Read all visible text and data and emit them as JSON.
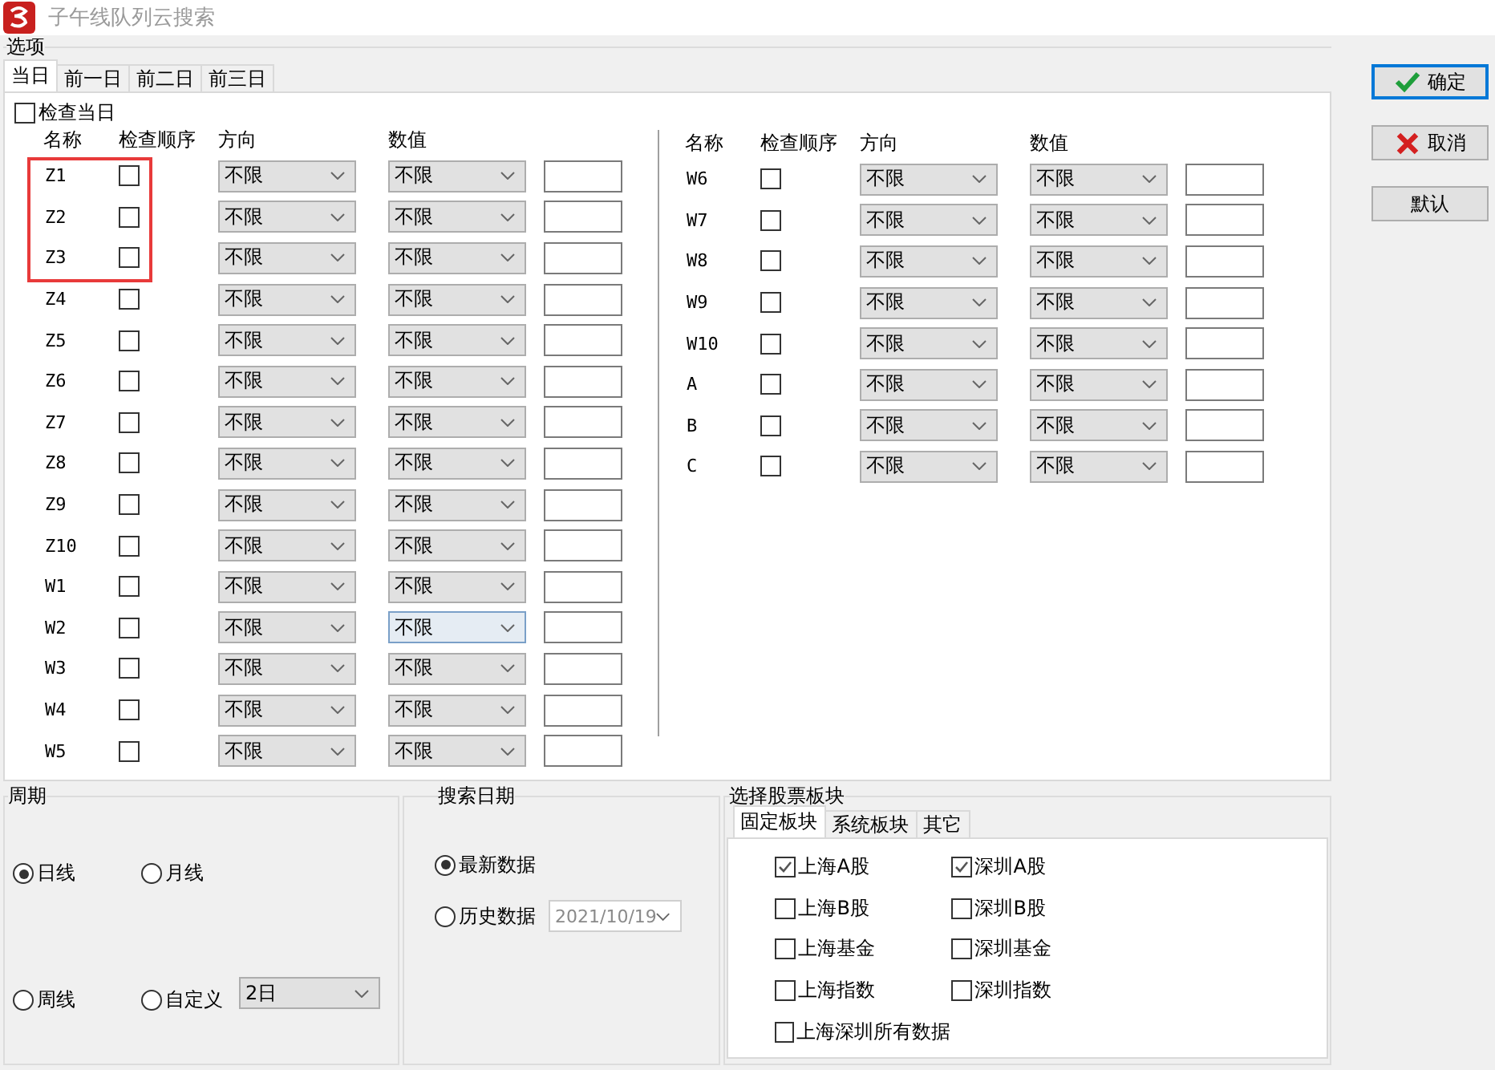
{
  "window": {
    "title": "子午线队列云搜索"
  },
  "options": {
    "label": "选项",
    "tabs": [
      {
        "label": "当日",
        "selected": true
      },
      {
        "label": "前一日",
        "selected": false
      },
      {
        "label": "前二日",
        "selected": false
      },
      {
        "label": "前三日",
        "selected": false
      }
    ],
    "check_today": {
      "label": "检查当日",
      "checked": false
    },
    "panels": [
      {
        "headers": [
          "名称",
          "检查顺序",
          "方向",
          "数值"
        ],
        "rows": [
          {
            "name": "Z1",
            "order_checked": false,
            "direction": "不限",
            "value": "不限",
            "value_focused": false,
            "highlighted": true
          },
          {
            "name": "Z2",
            "order_checked": false,
            "direction": "不限",
            "value": "不限",
            "value_focused": false,
            "highlighted": true
          },
          {
            "name": "Z3",
            "order_checked": false,
            "direction": "不限",
            "value": "不限",
            "value_focused": false,
            "highlighted": true
          },
          {
            "name": "Z4",
            "order_checked": false,
            "direction": "不限",
            "value": "不限",
            "value_focused": false,
            "highlighted": false
          },
          {
            "name": "Z5",
            "order_checked": false,
            "direction": "不限",
            "value": "不限",
            "value_focused": false,
            "highlighted": false
          },
          {
            "name": "Z6",
            "order_checked": false,
            "direction": "不限",
            "value": "不限",
            "value_focused": false,
            "highlighted": false
          },
          {
            "name": "Z7",
            "order_checked": false,
            "direction": "不限",
            "value": "不限",
            "value_focused": false,
            "highlighted": false
          },
          {
            "name": "Z8",
            "order_checked": false,
            "direction": "不限",
            "value": "不限",
            "value_focused": false,
            "highlighted": false
          },
          {
            "name": "Z9",
            "order_checked": false,
            "direction": "不限",
            "value": "不限",
            "value_focused": false,
            "highlighted": false
          },
          {
            "name": "Z10",
            "order_checked": false,
            "direction": "不限",
            "value": "不限",
            "value_focused": false,
            "highlighted": false
          },
          {
            "name": "W1",
            "order_checked": false,
            "direction": "不限",
            "value": "不限",
            "value_focused": false,
            "highlighted": false
          },
          {
            "name": "W2",
            "order_checked": false,
            "direction": "不限",
            "value": "不限",
            "value_focused": true,
            "highlighted": false
          },
          {
            "name": "W3",
            "order_checked": false,
            "direction": "不限",
            "value": "不限",
            "value_focused": false,
            "highlighted": false
          },
          {
            "name": "W4",
            "order_checked": false,
            "direction": "不限",
            "value": "不限",
            "value_focused": false,
            "highlighted": false
          },
          {
            "name": "W5",
            "order_checked": false,
            "direction": "不限",
            "value": "不限",
            "value_focused": false,
            "highlighted": false
          }
        ]
      },
      {
        "headers": [
          "名称",
          "检查顺序",
          "方向",
          "数值"
        ],
        "rows": [
          {
            "name": "W6",
            "order_checked": false,
            "direction": "不限",
            "value": "不限",
            "value_focused": false,
            "highlighted": false
          },
          {
            "name": "W7",
            "order_checked": false,
            "direction": "不限",
            "value": "不限",
            "value_focused": false,
            "highlighted": false
          },
          {
            "name": "W8",
            "order_checked": false,
            "direction": "不限",
            "value": "不限",
            "value_focused": false,
            "highlighted": false
          },
          {
            "name": "W9",
            "order_checked": false,
            "direction": "不限",
            "value": "不限",
            "value_focused": false,
            "highlighted": false
          },
          {
            "name": "W10",
            "order_checked": false,
            "direction": "不限",
            "value": "不限",
            "value_focused": false,
            "highlighted": false
          },
          {
            "name": "A",
            "order_checked": false,
            "direction": "不限",
            "value": "不限",
            "value_focused": false,
            "highlighted": false
          },
          {
            "name": "B",
            "order_checked": false,
            "direction": "不限",
            "value": "不限",
            "value_focused": false,
            "highlighted": false
          },
          {
            "name": "C",
            "order_checked": false,
            "direction": "不限",
            "value": "不限",
            "value_focused": false,
            "highlighted": false
          }
        ]
      }
    ]
  },
  "period": {
    "label": "周期",
    "options": [
      {
        "label": "日线",
        "selected": true
      },
      {
        "label": "月线",
        "selected": false
      },
      {
        "label": "周线",
        "selected": false
      },
      {
        "label": "自定义",
        "selected": false
      }
    ],
    "custom": "2日"
  },
  "search_date": {
    "label": "搜索日期",
    "options": [
      {
        "label": "最新数据",
        "selected": true
      },
      {
        "label": "历史数据",
        "selected": false
      }
    ],
    "date": {
      "value": "2021/10/19",
      "disabled": true
    }
  },
  "board": {
    "label": "选择股票板块",
    "tabs": [
      {
        "label": "固定板块",
        "selected": true
      },
      {
        "label": "系统板块",
        "selected": false
      },
      {
        "label": "其它",
        "selected": false
      }
    ],
    "items": [
      {
        "label": "上海A股",
        "checked": true
      },
      {
        "label": "深圳A股",
        "checked": true
      },
      {
        "label": "上海B股",
        "checked": false
      },
      {
        "label": "深圳B股",
        "checked": false
      },
      {
        "label": "上海基金",
        "checked": false
      },
      {
        "label": "深圳基金",
        "checked": false
      },
      {
        "label": "上海指数",
        "checked": false
      },
      {
        "label": "深圳指数",
        "checked": false
      },
      {
        "label": "上海深圳所有数据",
        "checked": false
      }
    ]
  },
  "buttons": [
    {
      "label": "确定",
      "kind": "ok",
      "focused": true
    },
    {
      "label": "取消",
      "kind": "cancel",
      "focused": false
    },
    {
      "label": "默认",
      "kind": "plain",
      "focused": false
    }
  ]
}
